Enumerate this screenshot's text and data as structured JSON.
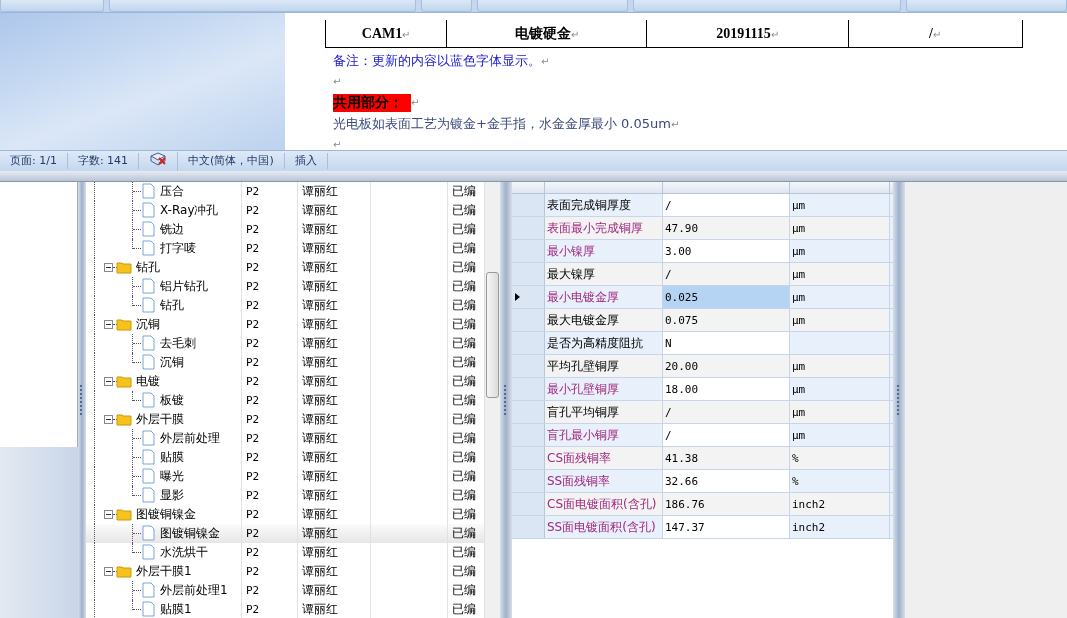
{
  "document": {
    "table_row": [
      {
        "text": "CAM1",
        "mark": "↵"
      },
      {
        "text": "电镀硬金",
        "mark": "↵"
      },
      {
        "text": "20191115",
        "mark": "↵"
      },
      {
        "text": "/",
        "mark": "↵"
      }
    ],
    "paragraphs": [
      {
        "kind": "note",
        "text": "备注：更新的内容以蓝色字体显示。",
        "mark": "↵"
      },
      {
        "kind": "empty",
        "mark": "↵"
      },
      {
        "kind": "heading",
        "text": "共用部分：",
        "mark": "↵"
      },
      {
        "kind": "body",
        "text": "光电板如表面工艺为镀金+金手指，水金金厚最小 0.05um",
        "mark": "↵"
      },
      {
        "kind": "empty",
        "mark": "↵"
      }
    ]
  },
  "status_bar": [
    {
      "kind": "text",
      "text": "页面: 1/1"
    },
    {
      "kind": "text",
      "text": "字数: 141"
    },
    {
      "kind": "icon"
    },
    {
      "kind": "text",
      "text": "中文(简体，中国)"
    },
    {
      "kind": "text",
      "text": "插入"
    }
  ],
  "tree": {
    "groups": [
      {
        "children": [
          {
            "label": "压合",
            "priority": "P2",
            "owner": "谭丽红",
            "status": "已编",
            "selected": false
          },
          {
            "label": "X-Ray冲孔",
            "priority": "P2",
            "owner": "谭丽红",
            "status": "已编",
            "selected": false
          },
          {
            "label": "铣边",
            "priority": "P2",
            "owner": "谭丽红",
            "status": "已编",
            "selected": false
          },
          {
            "label": "打字唛",
            "priority": "P2",
            "owner": "谭丽红",
            "status": "已编",
            "selected": false
          }
        ]
      },
      {
        "label": "钻孔",
        "priority": "P2",
        "owner": "谭丽红",
        "status": "已编",
        "selected": false,
        "expanded": true,
        "children": [
          {
            "label": "铝片钻孔",
            "priority": "P2",
            "owner": "谭丽红",
            "status": "已编",
            "selected": false
          },
          {
            "label": "钻孔",
            "priority": "P2",
            "owner": "谭丽红",
            "status": "已编",
            "selected": false
          }
        ]
      },
      {
        "label": "沉铜",
        "priority": "P2",
        "owner": "谭丽红",
        "status": "已编",
        "selected": false,
        "expanded": true,
        "children": [
          {
            "label": "去毛刺",
            "priority": "P2",
            "owner": "谭丽红",
            "status": "已编",
            "selected": false
          },
          {
            "label": "沉铜",
            "priority": "P2",
            "owner": "谭丽红",
            "status": "已编",
            "selected": false
          }
        ]
      },
      {
        "label": "电镀",
        "priority": "P2",
        "owner": "谭丽红",
        "status": "已编",
        "selected": false,
        "expanded": true,
        "children": [
          {
            "label": "板镀",
            "priority": "P2",
            "owner": "谭丽红",
            "status": "已编",
            "selected": false
          }
        ]
      },
      {
        "label": "外层干膜",
        "priority": "P2",
        "owner": "谭丽红",
        "status": "已编",
        "selected": false,
        "expanded": true,
        "children": [
          {
            "label": "外层前处理",
            "priority": "P2",
            "owner": "谭丽红",
            "status": "已编",
            "selected": false
          },
          {
            "label": "贴膜",
            "priority": "P2",
            "owner": "谭丽红",
            "status": "已编",
            "selected": false
          },
          {
            "label": "曝光",
            "priority": "P2",
            "owner": "谭丽红",
            "status": "已编",
            "selected": false
          },
          {
            "label": "显影",
            "priority": "P2",
            "owner": "谭丽红",
            "status": "已编",
            "selected": false
          }
        ]
      },
      {
        "label": "图镀铜镍金",
        "priority": "P2",
        "owner": "谭丽红",
        "status": "已编",
        "selected": false,
        "expanded": true,
        "children": [
          {
            "label": "图镀铜镍金",
            "priority": "P2",
            "owner": "谭丽红",
            "status": "已编",
            "selected": true
          },
          {
            "label": "水洗烘干",
            "priority": "P2",
            "owner": "谭丽红",
            "status": "已编",
            "selected": false
          }
        ]
      },
      {
        "label": "外层干膜1",
        "priority": "P2",
        "owner": "谭丽红",
        "status": "已编",
        "selected": false,
        "expanded": true,
        "children": [
          {
            "label": "外层前处理1",
            "priority": "P2",
            "owner": "谭丽红",
            "status": "已编",
            "selected": false
          },
          {
            "label": "贴膜1",
            "priority": "P2",
            "owner": "谭丽红",
            "status": "已编",
            "selected": false
          }
        ]
      }
    ]
  },
  "properties": [
    {
      "name": "表面完成铜厚度",
      "value": "/",
      "unit": "μm",
      "highlighted": false,
      "selected": false
    },
    {
      "name": "表面最小完成铜厚",
      "value": "47.90",
      "unit": "μm",
      "highlighted": true,
      "selected": false
    },
    {
      "name": "最小镍厚",
      "value": "3.00",
      "unit": "μm",
      "highlighted": true,
      "selected": false
    },
    {
      "name": "最大镍厚",
      "value": "/",
      "unit": "μm",
      "highlighted": false,
      "selected": false
    },
    {
      "name": "最小电镀金厚",
      "value": "0.025",
      "unit": "μm",
      "highlighted": true,
      "selected": true
    },
    {
      "name": "最大电镀金厚",
      "value": "0.075",
      "unit": "μm",
      "highlighted": false,
      "selected": false
    },
    {
      "name": "是否为高精度阻抗",
      "value": "N",
      "highlighted": false,
      "selected": false
    },
    {
      "name": "平均孔壁铜厚",
      "value": "20.00",
      "unit": "μm",
      "highlighted": false,
      "selected": false
    },
    {
      "name": "最小孔壁铜厚",
      "value": "18.00",
      "unit": "μm",
      "highlighted": true,
      "selected": false
    },
    {
      "name": "盲孔平均铜厚",
      "value": "/",
      "unit": "μm",
      "highlighted": false,
      "selected": false
    },
    {
      "name": "盲孔最小铜厚",
      "value": "/",
      "unit": "μm",
      "highlighted": true,
      "selected": false
    },
    {
      "name": "CS面残铜率",
      "value": "41.38",
      "unit": "%",
      "highlighted": true,
      "selected": false
    },
    {
      "name": "SS面残铜率",
      "value": "32.66",
      "unit": "%",
      "highlighted": true,
      "selected": false
    },
    {
      "name": "CS面电镀面积(含孔)",
      "value": "186.76",
      "unit": "inch2",
      "highlighted": true,
      "selected": false
    },
    {
      "name": "SS面电镀面积(含孔)",
      "value": "147.37",
      "unit": "inch2",
      "highlighted": true,
      "selected": false
    }
  ]
}
